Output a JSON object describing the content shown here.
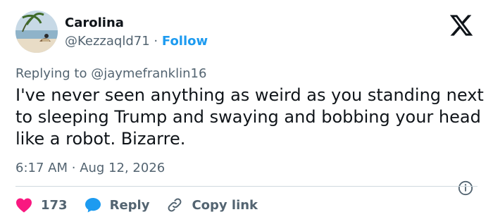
{
  "author": {
    "name": "Carolina",
    "handle": "@Kezzaqld71",
    "separator": "·",
    "follow_label": "Follow"
  },
  "reply_context": {
    "prefix": "Replying to",
    "handle": "@jaymefranklin16"
  },
  "tweet": {
    "text": "I've never seen anything as weird as you standing next to sleeping Trump and swaying and bobbing your head like a robot. Bizarre."
  },
  "meta": {
    "time": "6:17 AM",
    "separator": "·",
    "date": "Aug 12, 2026"
  },
  "actions": {
    "like_count": "173",
    "reply_label": "Reply",
    "copy_label": "Copy link"
  },
  "colors": {
    "accent": "#1d9bf0",
    "like": "#f91880",
    "muted": "#536471",
    "text": "#0f1419"
  },
  "icons": [
    "x-logo-icon",
    "info-icon",
    "heart-icon",
    "reply-bubble-icon",
    "link-icon"
  ]
}
